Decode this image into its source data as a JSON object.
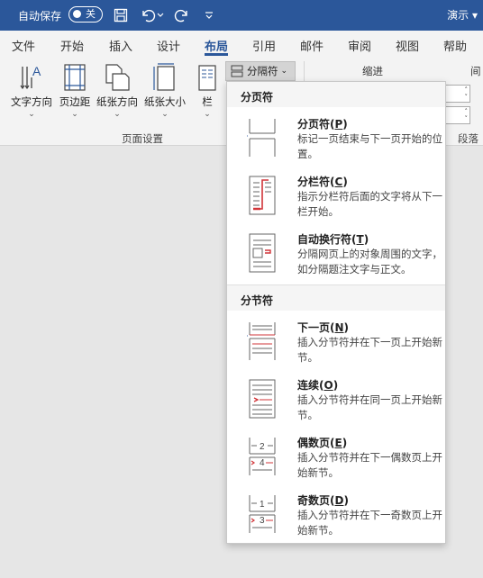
{
  "titlebar": {
    "autosave_label": "自动保存",
    "toggle_state": "关",
    "presenter": "演示"
  },
  "tabs": [
    "文件",
    "开始",
    "插入",
    "设计",
    "布局",
    "引用",
    "邮件",
    "审阅",
    "视图",
    "帮助"
  ],
  "active_tab": "布局",
  "ribbon": {
    "buttons": {
      "text_direction": "文字方向",
      "margins": "页边距",
      "orientation": "纸张方向",
      "size": "纸张大小",
      "columns": "栏"
    },
    "breaks_label": "分隔符",
    "page_setup_group": "页面设置",
    "indent_label": "缩进",
    "spacing_label": "间",
    "paragraph_group": "段落"
  },
  "menu": {
    "page_breaks_header": "分页符",
    "section_breaks_header": "分节符",
    "items": [
      {
        "title": "分页符",
        "key": "P",
        "desc": "标记一页结束与下一页开始的位置。"
      },
      {
        "title": "分栏符",
        "key": "C",
        "desc": "指示分栏符后面的文字将从下一栏开始。"
      },
      {
        "title": "自动换行符",
        "key": "T",
        "desc": "分隔网页上的对象周围的文字，如分隔题注文字与正文。"
      },
      {
        "title": "下一页",
        "key": "N",
        "desc": "插入分节符并在下一页上开始新节。"
      },
      {
        "title": "连续",
        "key": "O",
        "desc": "插入分节符并在同一页上开始新节。"
      },
      {
        "title": "偶数页",
        "key": "E",
        "desc": "插入分节符并在下一偶数页上开始新节。"
      },
      {
        "title": "奇数页",
        "key": "D",
        "desc": "插入分节符并在下一奇数页上开始新节。"
      }
    ]
  },
  "colors": {
    "titlebar": "#2b579a",
    "accent_red": "#d13438",
    "accent_blue": "#2b579a"
  }
}
